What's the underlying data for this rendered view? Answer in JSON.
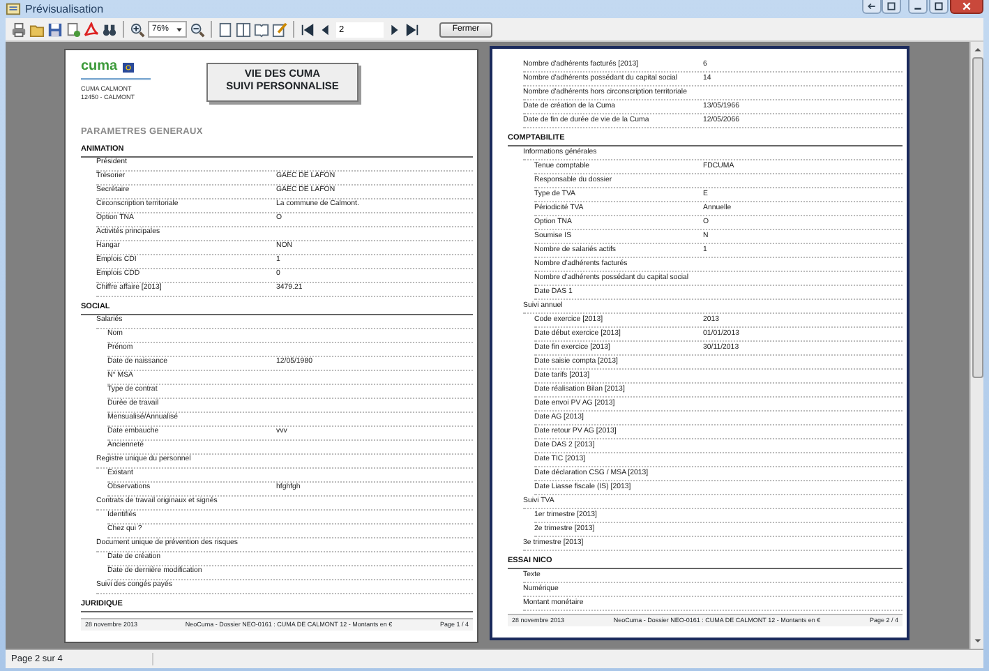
{
  "window": {
    "title": "Prévisualisation"
  },
  "toolbar": {
    "zoom": "76%",
    "page_number": "2",
    "close_button": "Fermer"
  },
  "pages": [
    {
      "selected": false,
      "header": {
        "logo": "cuma",
        "address": [
          "CUMA  CALMONT",
          "12450 - CALMONT"
        ],
        "title": [
          "VIE DES CUMA",
          "SUIVI PERSONNALISE"
        ],
        "heading": "PARAMETRES GENERAUX"
      },
      "sections": [
        {
          "title": "ANIMATION",
          "rows": [
            {
              "label": "Président"
            },
            {
              "label": "Trésorier",
              "value": "GAEC DE LAFON"
            },
            {
              "label": "Secrétaire",
              "value": "GAEC DE LAFON"
            },
            {
              "label": "Circonscription territoriale",
              "value": "La commune de Calmont."
            },
            {
              "label": "Option TNA",
              "value": "O"
            },
            {
              "label": "Activités principales"
            },
            {
              "label": "Hangar",
              "value": "NON"
            },
            {
              "label": "Emplois CDI",
              "value": "1"
            },
            {
              "label": "Emplois CDD",
              "value": "0"
            },
            {
              "label": "Chiffre affaire [2013]",
              "value": "3479.21"
            }
          ]
        },
        {
          "title": "SOCIAL",
          "rows": [
            {
              "label": "Salariés",
              "children": [
                {
                  "label": "Nom"
                },
                {
                  "label": "Prénom"
                },
                {
                  "label": "Date de naissance",
                  "value": "12/05/1980"
                },
                {
                  "label": "N° MSA"
                },
                {
                  "label": "Type de contrat"
                },
                {
                  "label": "Durée de travail"
                },
                {
                  "label": "Mensualisé/Annualisé"
                },
                {
                  "label": "Date embauche",
                  "value": "vvv"
                },
                {
                  "label": "Ancienneté"
                }
              ]
            },
            {
              "label": "Registre unique du personnel",
              "children": [
                {
                  "label": "Existant"
                },
                {
                  "label": "Observations",
                  "value": "hfghfgh"
                }
              ]
            },
            {
              "label": "Contrats de travail originaux et signés",
              "children": [
                {
                  "label": "Identifiés"
                },
                {
                  "label": "Chez qui ?"
                }
              ]
            },
            {
              "label": "Document unique de prévention des risques",
              "children": [
                {
                  "label": "Date de création"
                },
                {
                  "label": "Date de dernière modification"
                }
              ]
            },
            {
              "label": "Suivi des congés payés"
            }
          ]
        },
        {
          "title": "JURIDIQUE"
        }
      ],
      "footer": {
        "date": "28 novembre 2013",
        "center": "NeoCuma - Dossier NEO-0161 : CUMA DE CALMONT 12 - Montants en €",
        "page": "Page 1 / 4"
      }
    },
    {
      "selected": true,
      "sections": [
        {
          "rows": [
            {
              "label": "Nombre d'adhérents facturés [2013]",
              "value": "6"
            },
            {
              "label": "Nombre d'adhérents possédant du capital social",
              "value": "14"
            },
            {
              "label": "Nombre d'adhérents hors circonscription territoriale"
            },
            {
              "label": "Date de création de la Cuma",
              "value": "13/05/1966"
            },
            {
              "label": "Date de fin de durée de vie de la Cuma",
              "value": "12/05/2066"
            }
          ]
        },
        {
          "title": "COMPTABILITE",
          "rows": [
            {
              "label": "Informations générales",
              "children": [
                {
                  "label": "Tenue comptable",
                  "value": "FDCUMA"
                },
                {
                  "label": "Responsable du dossier"
                },
                {
                  "label": "Type de TVA",
                  "value": "E"
                },
                {
                  "label": "Périodicité TVA",
                  "value": "Annuelle"
                },
                {
                  "label": "Option TNA",
                  "value": "O"
                },
                {
                  "label": "Soumise IS",
                  "value": "N"
                },
                {
                  "label": "Nombre de salariés actifs",
                  "value": "1"
                },
                {
                  "label": "Nombre d'adhérents facturés"
                },
                {
                  "label": "Nombre d'adhérents possédant du capital social"
                },
                {
                  "label": "Date DAS 1"
                }
              ]
            },
            {
              "label": "Suivi annuel",
              "children": [
                {
                  "label": "Code exercice [2013]",
                  "value": "2013"
                },
                {
                  "label": "Date début exercice [2013]",
                  "value": "01/01/2013"
                },
                {
                  "label": "Date fin exercice [2013]",
                  "value": "30/11/2013"
                },
                {
                  "label": "Date saisie compta [2013]"
                },
                {
                  "label": "Date tarifs [2013]"
                },
                {
                  "label": "Date réalisation Bilan [2013]"
                },
                {
                  "label": "Date envoi PV AG [2013]"
                },
                {
                  "label": "Date AG [2013]"
                },
                {
                  "label": "Date retour PV AG [2013]"
                },
                {
                  "label": "Date DAS 2 [2013]"
                },
                {
                  "label": "Date TIC [2013]"
                },
                {
                  "label": "Date déclaration CSG / MSA [2013]"
                },
                {
                  "label": "Date Liasse fiscale (IS) [2013]"
                }
              ]
            },
            {
              "label": "Suivi TVA",
              "children": [
                {
                  "label": "1er trimestre [2013]"
                },
                {
                  "label": "2e trimestre [2013]"
                }
              ]
            },
            {
              "label": "3e trimestre [2013]"
            }
          ]
        },
        {
          "title": "ESSAI NICO",
          "rows": [
            {
              "label": "Texte"
            },
            {
              "label": "Numérique"
            },
            {
              "label": "Montant monétaire"
            }
          ]
        }
      ],
      "footer": {
        "date": "28 novembre 2013",
        "center": "NeoCuma - Dossier NEO-0161 : CUMA DE CALMONT 12 - Montants en €",
        "page": "Page 2 / 4"
      }
    }
  ],
  "status_bar": {
    "text": "Page 2 sur 4"
  }
}
